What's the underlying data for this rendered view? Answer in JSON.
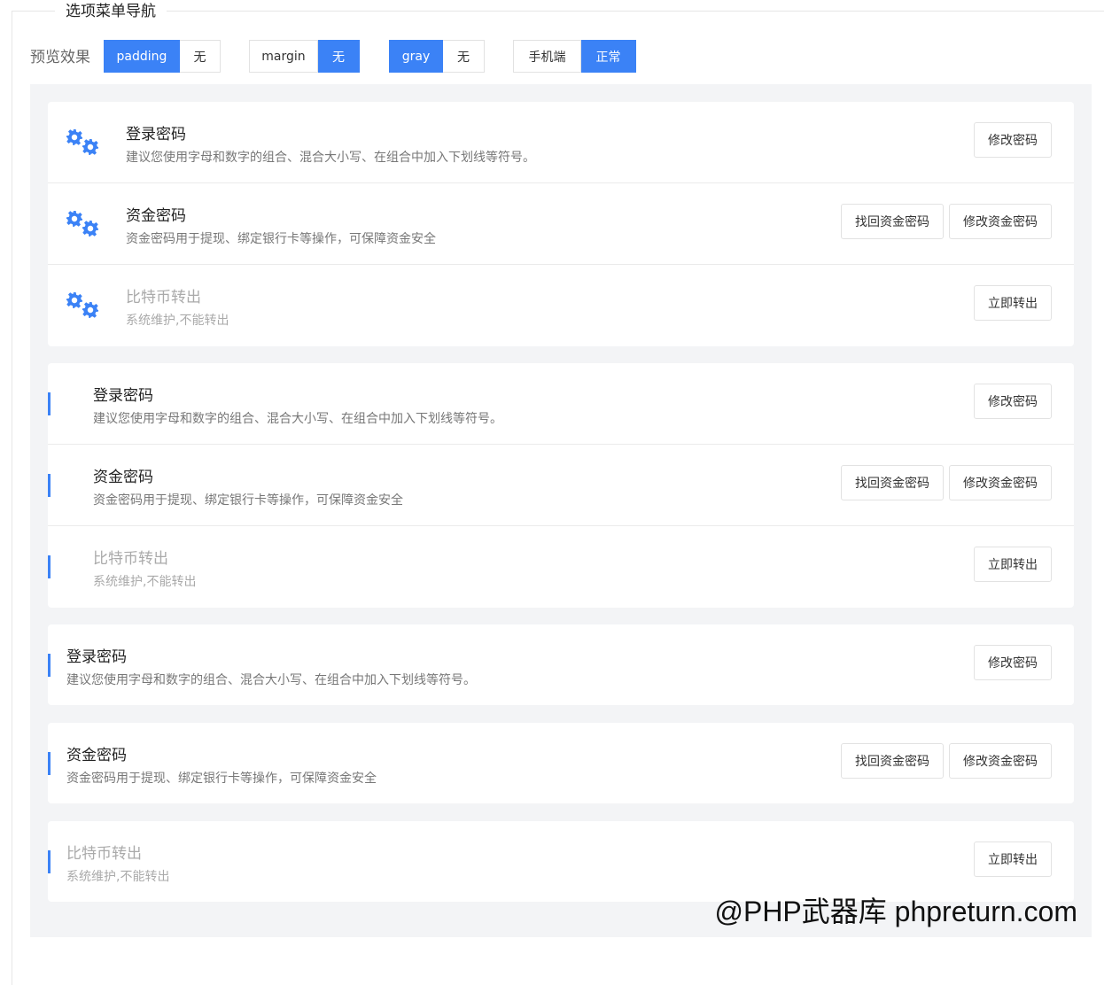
{
  "legend": "选项菜单导航",
  "toolbar": {
    "label": "预览效果",
    "groups": [
      {
        "options": [
          "padding",
          "无"
        ],
        "active": 0
      },
      {
        "options": [
          "margin",
          "无"
        ],
        "active": 1
      },
      {
        "options": [
          "gray",
          "无"
        ],
        "active": 0
      },
      {
        "options": [
          "手机端",
          "正常"
        ],
        "active": 1
      }
    ]
  },
  "items": {
    "login": {
      "title": "登录密码",
      "desc": "建议您使用字母和数字的组合、混合大小写、在组合中加入下划线等符号。",
      "buttons": [
        "修改密码"
      ]
    },
    "fund": {
      "title": "资金密码",
      "desc": "资金密码用于提现、绑定银行卡等操作，可保障资金安全",
      "buttons": [
        "找回资金密码",
        "修改资金密码"
      ]
    },
    "btc": {
      "title": "比特币转出",
      "desc": "系统维护,不能转出",
      "buttons": [
        "立即转出"
      ]
    }
  },
  "accent_color": "#3b82f6",
  "icon": "gears-icon",
  "watermark": "@PHP武器库 phpreturn.com"
}
